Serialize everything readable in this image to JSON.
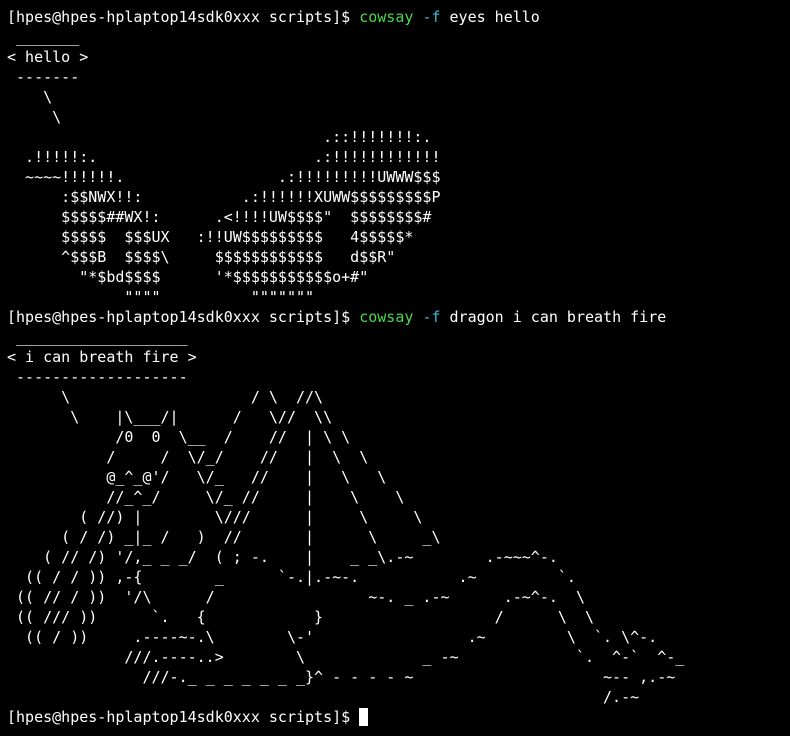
{
  "terminal": {
    "colors": {
      "background": "#000000",
      "foreground": "#ffffff",
      "command": "#4bd84b",
      "flag": "#3fb7d0"
    },
    "prompt": "[hpes@hpes-hplaptop14sdk0xxx scripts]$ ",
    "commands": [
      {
        "name": "cowsay",
        "flag": "-f",
        "args": "eyes hello",
        "output": [
          " _______",
          "< hello >",
          " -------",
          "    \\",
          "     \\",
          "                                   .::!!!!!!!:.",
          "  .!!!!!:.                        .:!!!!!!!!!!!!",
          "  ~~~~!!!!!!.                 .:!!!!!!!!!UWWW$$$",
          "      :$$NWX!!:           .:!!!!!!XUWW$$$$$$$$$P",
          "      $$$$$##WX!:      .<!!!!UW$$$$\"  $$$$$$$$#",
          "      $$$$$  $$$UX   :!!UW$$$$$$$$$   4$$$$$*",
          "      ^$$$B  $$$$\\     $$$$$$$$$$$$   d$$R\"",
          "        \"*$bd$$$$      '*$$$$$$$$$$$o+#\"",
          "             \"\"\"\"          \"\"\"\"\"\"\""
        ]
      },
      {
        "name": "cowsay",
        "flag": "-f",
        "args": "dragon i can breath fire",
        "output": [
          " ___________________",
          "< i can breath fire >",
          " -------------------",
          "      \\                    / \\  //\\",
          "       \\    |\\___/|      /   \\//  \\\\",
          "            /0  0  \\__  /    //  | \\ \\",
          "           /     /  \\/_/    //   |  \\  \\",
          "           @_^_@'/   \\/_   //    |   \\   \\",
          "           //_^_/     \\/_ //     |    \\    \\",
          "        ( //) |        \\///      |     \\     \\",
          "      ( / /) _|_ /   )  //       |      \\     _\\",
          "    ( // /) '/,_ _ _/  ( ; -.    |    _ _\\.-~        .-~~~^-.",
          "  (( / / )) ,-{        _      `-.|.-~-.           .~         `.",
          " (( // / ))  '/\\      /                 ~-. _ .-~      .-~^-.  \\",
          " (( /// ))      `.   {            }                   /      \\  \\",
          "  (( / ))     .----~-.\\        \\-'                 .~         \\  `. \\^-.",
          "             ///.----..>        \\             _ -~             `.  ^-`  ^-_",
          "               ///-._ _ _ _ _ _ _}^ - - - - ~                     ~-- ,.-~",
          "                                                                  /.-~"
        ]
      }
    ]
  }
}
